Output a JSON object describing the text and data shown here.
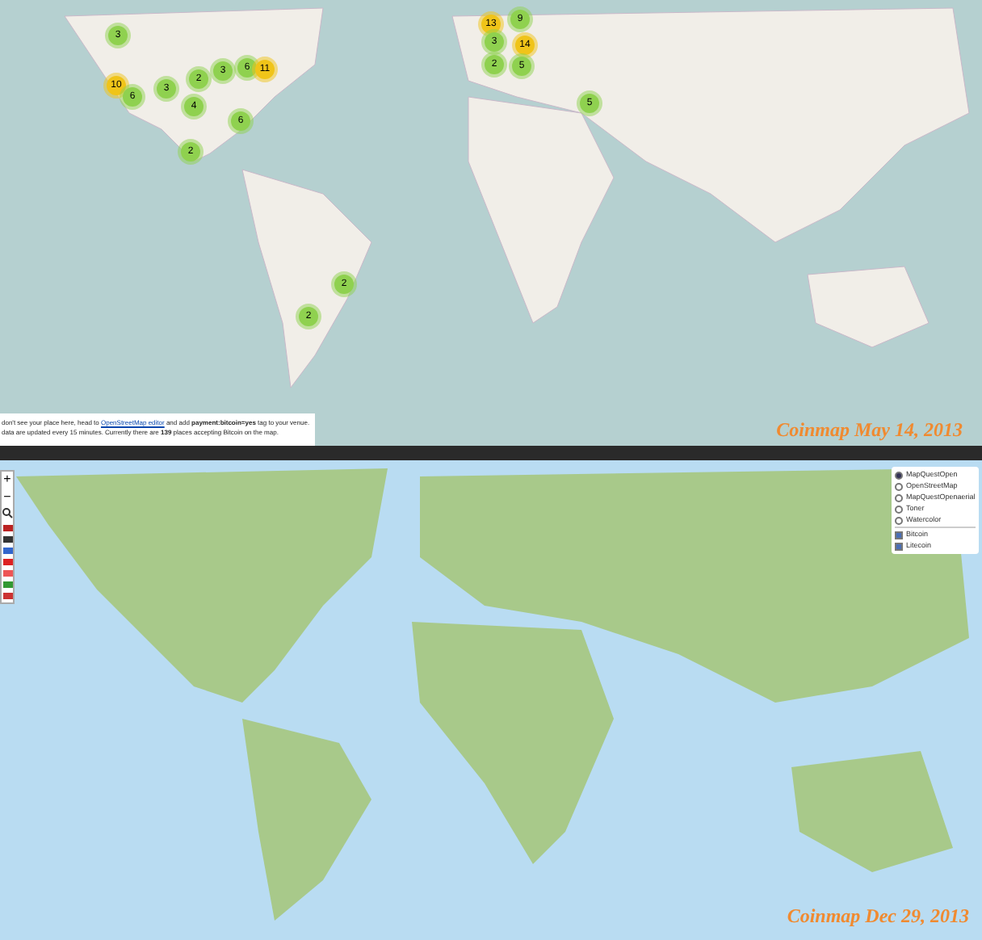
{
  "map_top": {
    "clusters": [
      {
        "count": "3"
      },
      {
        "count": "10"
      },
      {
        "count": "6"
      },
      {
        "count": "3"
      },
      {
        "count": "2"
      },
      {
        "count": "3"
      },
      {
        "count": "6"
      },
      {
        "count": "11"
      },
      {
        "count": "4"
      },
      {
        "count": "6"
      },
      {
        "count": "2"
      },
      {
        "count": "13"
      },
      {
        "count": "9"
      },
      {
        "count": "3"
      },
      {
        "count": "14"
      },
      {
        "count": "2"
      },
      {
        "count": "5"
      },
      {
        "count": "5"
      },
      {
        "count": "2"
      },
      {
        "count": "2"
      }
    ],
    "info_line_1": {
      "before": "don't see your place here, head to",
      "link": "OpenStreetMap editor",
      "after": "and add **payment:bitcoin=yes** tag to your venue."
    },
    "info_line_2": "data are updated every 15 minutes. Currently there are **139** places accepting Bitcoin on the map.",
    "caption": "Coinmap May 14, 2013"
  },
  "map_bottom": {
    "zoom_in": "+",
    "zoom_out": "−",
    "layers": [
      {
        "label": "MapQuestOpen",
        "selected": true
      },
      {
        "label": "OpenStreetMap",
        "selected": false
      },
      {
        "label": "MapQuestOpenaerial",
        "selected": false
      },
      {
        "label": "Toner",
        "selected": false
      },
      {
        "label": "Watercolor",
        "selected": false
      }
    ],
    "overlays": [
      {
        "label": "Bitcoin",
        "checked": true
      },
      {
        "label": "Litecoin",
        "checked": true
      }
    ],
    "caption": "Coinmap Dec 29, 2013"
  }
}
